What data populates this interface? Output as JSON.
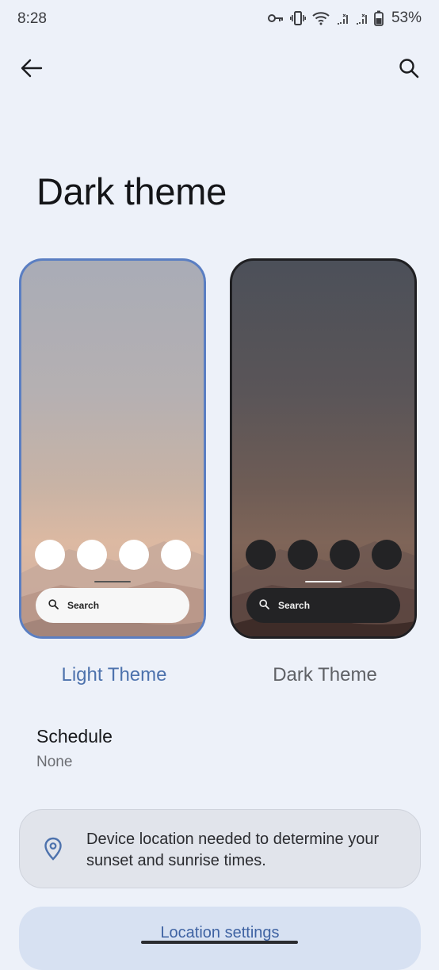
{
  "status_bar": {
    "time": "8:28",
    "battery": "53%",
    "icons": [
      "vpn-key-icon",
      "vibrate-icon",
      "wifi-icon",
      "signal-icon",
      "signal-icon",
      "battery-icon"
    ]
  },
  "top_bar": {
    "back_icon": "arrow-back-icon",
    "search_icon": "search-icon"
  },
  "page": {
    "title": "Dark theme"
  },
  "previews": {
    "light": {
      "label": "Light Theme",
      "search_text": "Search",
      "selected": true
    },
    "dark": {
      "label": "Dark Theme",
      "search_text": "Search",
      "selected": false
    }
  },
  "schedule": {
    "title": "Schedule",
    "value": "None"
  },
  "location_notice": {
    "text": "Device location needed to determine your sunset and sunrise times.",
    "icon": "location-pin-icon"
  },
  "location_settings": {
    "label": "Location settings"
  },
  "colors": {
    "background": "#edf1f9",
    "accent": "#4d72ad",
    "selected_border": "#5a7ec2"
  }
}
